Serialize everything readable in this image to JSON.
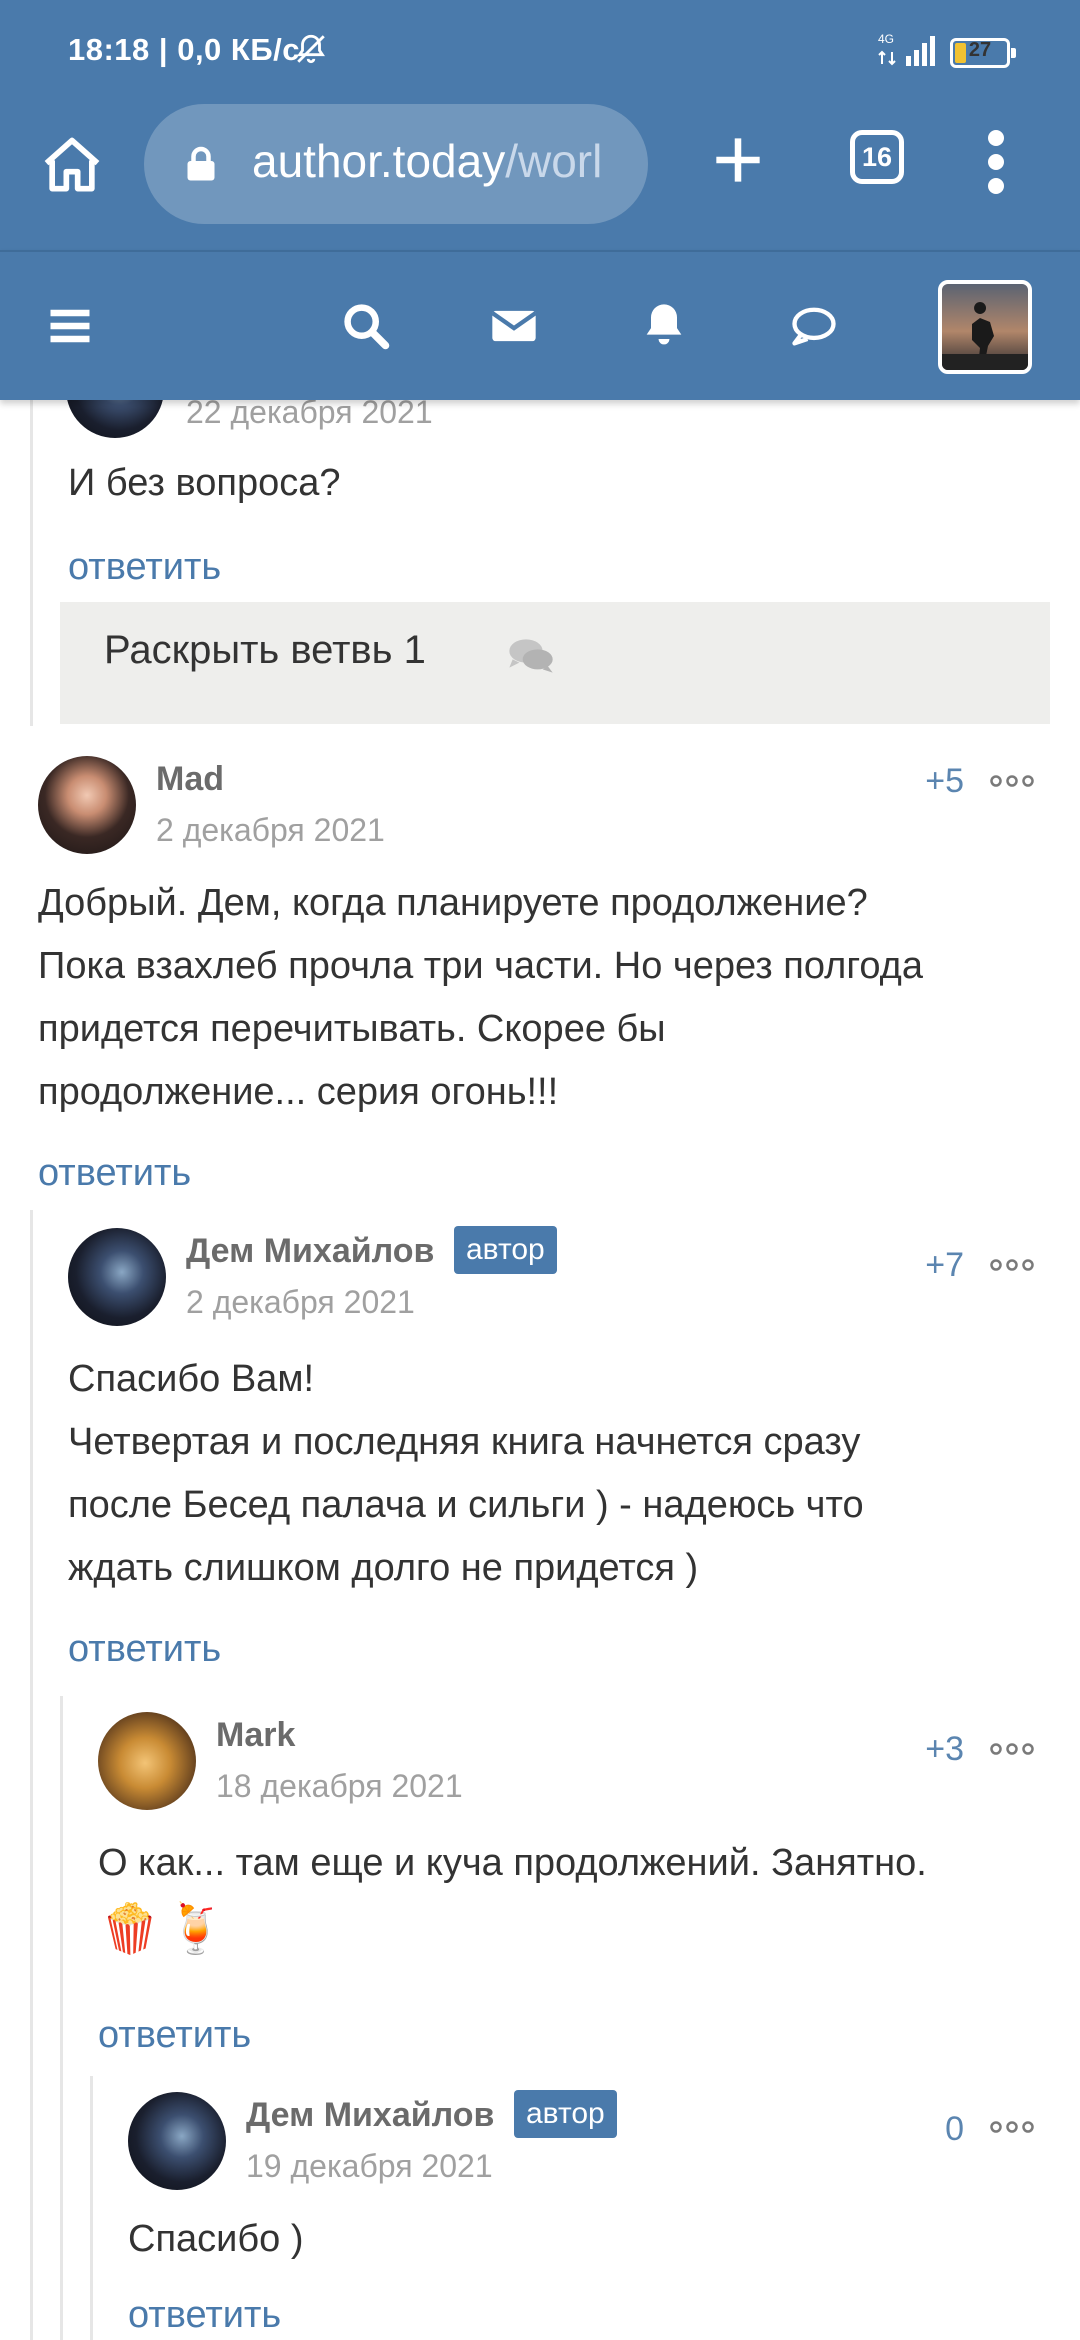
{
  "status_bar": {
    "time": "18:18",
    "speed": "0,0 КБ/с",
    "network": "4G",
    "battery": "27",
    "battery_level": 0.27
  },
  "browser": {
    "url_domain": "author.today",
    "url_path": "/worl",
    "tab_count": "16"
  },
  "site_nav": {
    "icons": [
      "menu-icon",
      "search-icon",
      "mail-icon",
      "bell-icon",
      "chat-icon"
    ]
  },
  "thread_top": {
    "date": "22 декабря 2021",
    "text": "И без вопроса?",
    "reply": "ответить",
    "expand_label": "Раскрыть ветвь 1"
  },
  "comments": [
    {
      "name": "Mad",
      "date": "2 декабря 2021",
      "rating": "+5",
      "lines": [
        "Добрый. Дем, когда планируете продолжение?",
        "Пока взахлеб прочла три части. Но через полгода",
        "придется перечитывать. Скорее бы",
        "продолжение... серия огонь!!!"
      ],
      "reply": "ответить"
    },
    {
      "name": "Дем Михайлов",
      "badge": "автор",
      "date": "2 декабря 2021",
      "rating": "+7",
      "lines": [
        "Спасибо Вам!",
        "Четвертая и последняя книга начнется сразу",
        "после Бесед палача и сильги ) - надеюсь что",
        "ждать слишком долго не придется )"
      ],
      "reply": "ответить"
    },
    {
      "name": "Mark",
      "date": "18 декабря 2021",
      "rating": "+3",
      "lines": [
        "О как... там еще и куча продолжений. Занятно."
      ],
      "emoji": [
        "🍿",
        "🍹"
      ],
      "reply": "ответить"
    },
    {
      "name": "Дем Михайлов",
      "badge": "автор",
      "date": "19 декабря 2021",
      "rating": "0",
      "lines": [
        "Спасибо )"
      ],
      "reply": "ответить"
    }
  ],
  "colors": {
    "brand": "#4a7aab",
    "link": "#4a7aab",
    "text": "#333333",
    "muted": "#a0a0a0"
  }
}
